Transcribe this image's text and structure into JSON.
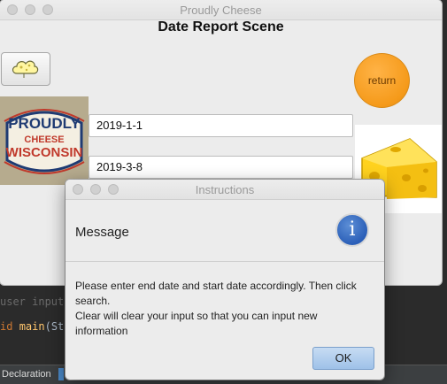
{
  "ide": {
    "line1": "user input",
    "line2_keyword": "id ",
    "line2_fn": "main",
    "line2_rest": "(Str",
    "tab_label": "Declaration"
  },
  "window": {
    "title": "Proudly Cheese",
    "scene_title": "Date Report Scene",
    "return_label": "return",
    "start_date": "2019-1-1",
    "end_date": "2019-3-8",
    "logo_text": {
      "top": "PROUDLY",
      "middle": "CHEESE",
      "bottom": "WISCONSIN"
    }
  },
  "dialog": {
    "title": "Instructions",
    "message_label": "Message",
    "info_glyph": "i",
    "body_lines": [
      "Please enter end date and start date accordingly. Then click",
      "search.",
      "Clear will clear your input so that you can input new",
      "information"
    ],
    "ok_label": "OK"
  },
  "colors": {
    "return_button": "#f59a1a",
    "ok_button": "#9ec1e8",
    "info_icon": "#2b5fb8",
    "logo_red": "#c0392b",
    "logo_blue": "#1f3b73"
  }
}
